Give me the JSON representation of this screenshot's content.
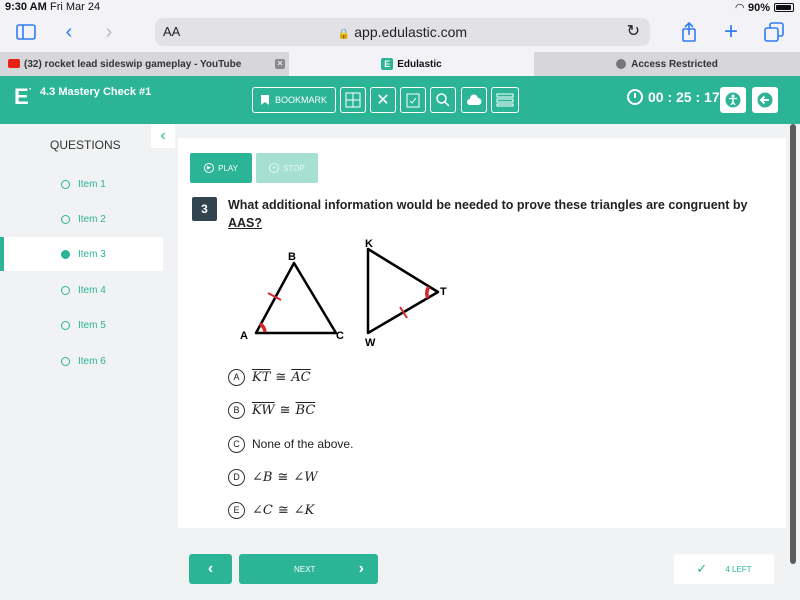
{
  "status_bar": {
    "time": "9:30 AM",
    "date": "Fri Mar 24",
    "battery": "90%"
  },
  "browser": {
    "aa_label": "AA",
    "url": "app.edulastic.com",
    "tabs": [
      {
        "label": "(32) rocket lead sideswip gameplay - YouTube"
      },
      {
        "label": "Edulastic"
      },
      {
        "label": "Access Restricted"
      }
    ]
  },
  "header": {
    "assignment_title": "4.3 Mastery Check #1",
    "bookmark_label": "BOOKMARK",
    "timer": "00 : 25 : 17"
  },
  "sidebar": {
    "title": "QUESTIONS",
    "items": [
      {
        "label": "Item 1"
      },
      {
        "label": "Item 2"
      },
      {
        "label": "Item 3"
      },
      {
        "label": "Item 4"
      },
      {
        "label": "Item 5"
      },
      {
        "label": "Item 6"
      }
    ],
    "active_index": 2
  },
  "question": {
    "play_label": "PLAY",
    "stop_label": "STOP",
    "number": "3",
    "text": "What additional information would be needed to prove these triangles are congruent by",
    "text_emphasis": "AAS?",
    "figure_labels": {
      "A": "A",
      "B": "B",
      "C": "C",
      "K": "K",
      "T": "T",
      "W": "W"
    },
    "options": [
      {
        "letter": "A",
        "left": "KT",
        "op": "≅",
        "right": "AC"
      },
      {
        "letter": "B",
        "left": "KW",
        "op": "≅",
        "right": "BC"
      },
      {
        "letter": "C",
        "text": "None of the above."
      },
      {
        "letter": "D",
        "left": "∠B",
        "op": "≅",
        "right": "∠W"
      },
      {
        "letter": "E",
        "left": "∠C",
        "op": "≅",
        "right": "∠K"
      }
    ]
  },
  "footer": {
    "next_label": "NEXT",
    "left_label": "4 LEFT"
  },
  "colors": {
    "accent": "#2bb496",
    "marks": "#d9262c",
    "qnum_bg": "#314450"
  }
}
